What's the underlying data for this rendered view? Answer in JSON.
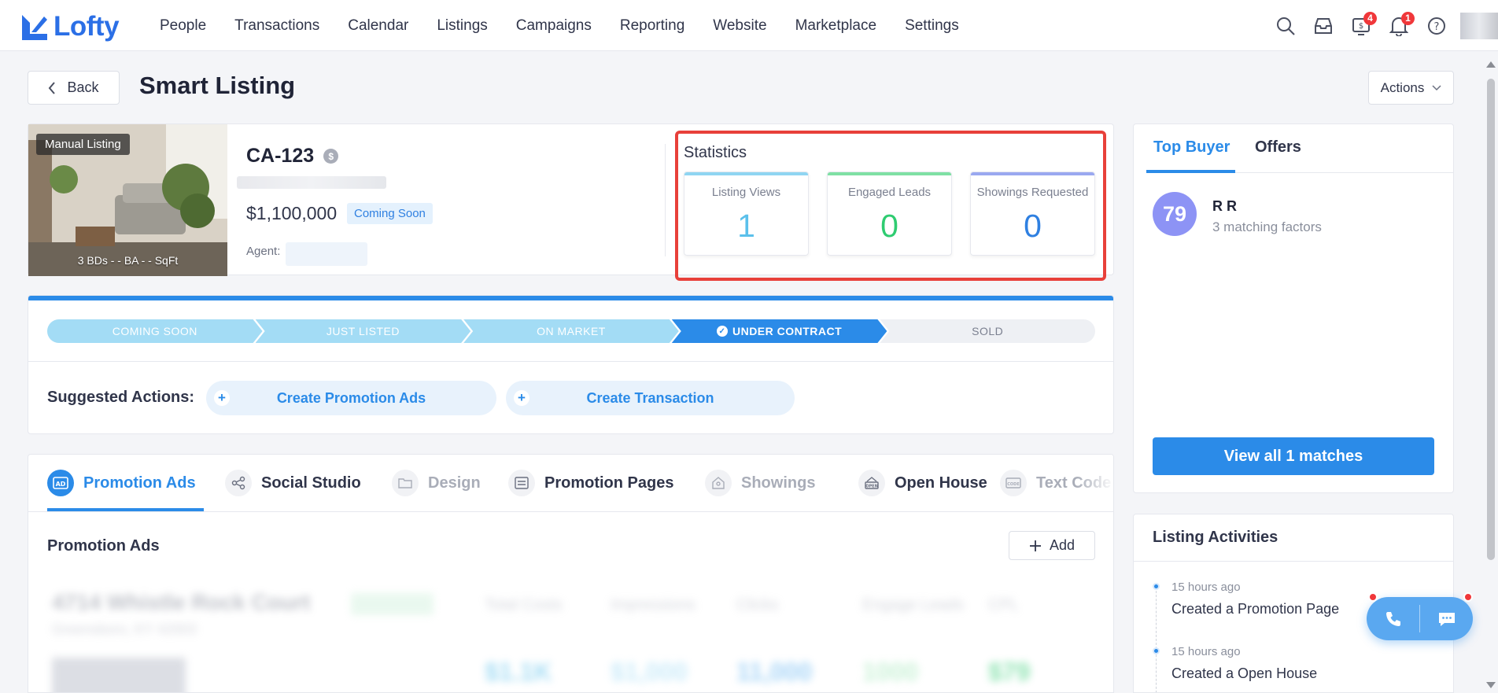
{
  "app": {
    "logo_text": "Lofty",
    "brand_color": "#2b6fe6",
    "accent_color": "#2b8be8"
  },
  "nav": {
    "items": [
      "People",
      "Transactions",
      "Calendar",
      "Listings",
      "Campaigns",
      "Reporting",
      "Website",
      "Marketplace",
      "Settings"
    ],
    "icons": [
      "search-icon",
      "inbox-icon",
      "tasks-icon",
      "bell-icon",
      "help-icon"
    ],
    "tasks_badge": "4",
    "bell_badge": "1"
  },
  "header": {
    "back_label": "Back",
    "title": "Smart Listing",
    "actions_label": "Actions"
  },
  "listing": {
    "photo_tag": "Manual Listing",
    "specs": "3 BDs - - BA - - SqFt",
    "id": "CA-123",
    "price": "$1,100,000",
    "status": "Coming Soon",
    "agent_label": "Agent:"
  },
  "statistics": {
    "title": "Statistics",
    "items": [
      {
        "label": "Listing Views",
        "value": "1",
        "color": "#5bc0eb"
      },
      {
        "label": "Engaged Leads",
        "value": "0",
        "color": "#2fcc71"
      },
      {
        "label": "Showings Requested",
        "value": "0",
        "color": "#2f80e1"
      }
    ],
    "highlight_color": "#e8403a"
  },
  "stages": {
    "items": [
      "COMING SOON",
      "JUST LISTED",
      "ON MARKET",
      "UNDER CONTRACT",
      "SOLD"
    ],
    "current": "UNDER CONTRACT"
  },
  "suggested": {
    "label": "Suggested Actions:",
    "actions": [
      "Create Promotion Ads",
      "Create Transaction"
    ]
  },
  "tabs": {
    "items": [
      "Promotion Ads",
      "Social Studio",
      "Design",
      "Promotion Pages",
      "Showings",
      "Open House",
      "Text Code"
    ],
    "active": "Promotion Ads"
  },
  "promotion": {
    "title": "Promotion Ads",
    "add_label": "Add",
    "blurred": {
      "address": "4714 Whistle Rock Court",
      "city": "Greensboro, KY 42003",
      "columns": [
        "Total Costs",
        "Impressions",
        "Clicks",
        "Engage Leads",
        "CPL"
      ],
      "values": [
        "$1.1K",
        "$1,000",
        "11,000",
        "1000",
        "$79"
      ]
    }
  },
  "buyer": {
    "tabs": [
      "Top Buyer",
      "Offers"
    ],
    "score": "79",
    "name": "R R",
    "factors": "3 matching factors",
    "view_all": "View all 1 matches"
  },
  "activities": {
    "title": "Listing Activities",
    "items": [
      {
        "time": "15 hours ago",
        "text": "Created a Promotion Page"
      },
      {
        "time": "15 hours ago",
        "text": "Created a Open House"
      }
    ]
  }
}
